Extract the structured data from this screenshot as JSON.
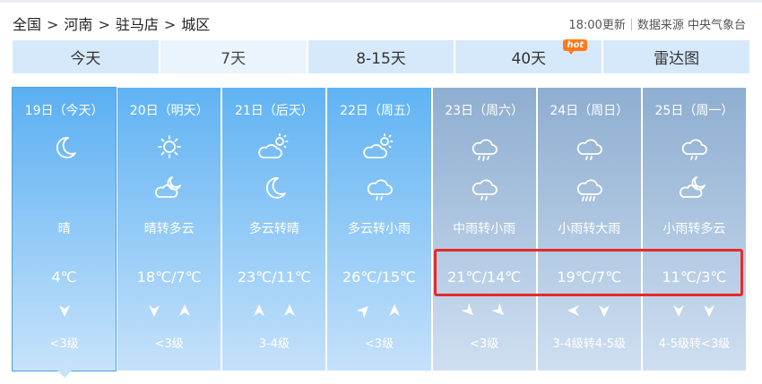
{
  "breadcrumb": [
    "全国",
    "河南",
    "驻马店",
    "城区"
  ],
  "breadcrumb_sep": ">",
  "update_time": "18:00更新",
  "source_label": "数据来源",
  "source_name": "中央气象台",
  "tabs": [
    {
      "label": "今天",
      "active": false
    },
    {
      "label": "7天",
      "active": true
    },
    {
      "label": "8-15天",
      "active": false
    },
    {
      "label": "40天",
      "active": false,
      "badge": "hot"
    },
    {
      "label": "雷达图",
      "active": false
    }
  ],
  "colors": {
    "today": "#5aaff2",
    "future": "#60b3f3",
    "later": "#8eaed0",
    "highlight": "#e62a2a"
  },
  "days": [
    {
      "date": "19日（今天）",
      "icons": [
        "moon-icon"
      ],
      "desc": "晴",
      "temp": "4℃",
      "winds": [
        "down"
      ],
      "level": "<3级",
      "style": "today"
    },
    {
      "date": "20日（明天）",
      "icons": [
        "sun-icon",
        "cloudy-night-icon"
      ],
      "desc": "晴转多云",
      "temp": "18℃/7℃",
      "winds": [
        "down",
        "up"
      ],
      "level": "<3级",
      "style": "blue"
    },
    {
      "date": "21日（后天）",
      "icons": [
        "partly-cloudy-icon",
        "moon-icon"
      ],
      "desc": "多云转晴",
      "temp": "23℃/11℃",
      "winds": [
        "up",
        "up"
      ],
      "level": "3-4级",
      "style": "blue"
    },
    {
      "date": "22日（周五）",
      "icons": [
        "partly-cloudy-icon",
        "light-rain-icon"
      ],
      "desc": "多云转小雨",
      "temp": "26℃/15℃",
      "winds": [
        "up-right",
        "up"
      ],
      "level": "<3级",
      "style": "blue"
    },
    {
      "date": "23日（周六）",
      "icons": [
        "moderate-rain-icon",
        "light-rain-icon"
      ],
      "desc": "中雨转小雨",
      "temp": "21℃/14℃",
      "winds": [
        "down-right",
        "down-right"
      ],
      "level": "<3级",
      "style": "gray"
    },
    {
      "date": "24日（周日）",
      "icons": [
        "light-rain-icon",
        "heavy-rain-icon"
      ],
      "desc": "小雨转大雨",
      "temp": "19℃/7℃",
      "winds": [
        "left",
        "down"
      ],
      "level": "3-4级转4-5级",
      "style": "gray"
    },
    {
      "date": "25日（周一）",
      "icons": [
        "light-rain-icon",
        "cloudy-night-icon"
      ],
      "desc": "小雨转多云",
      "temp": "11℃/3℃",
      "winds": [
        "down",
        "down"
      ],
      "level": "4-5级转<3级",
      "style": "gray"
    }
  ]
}
